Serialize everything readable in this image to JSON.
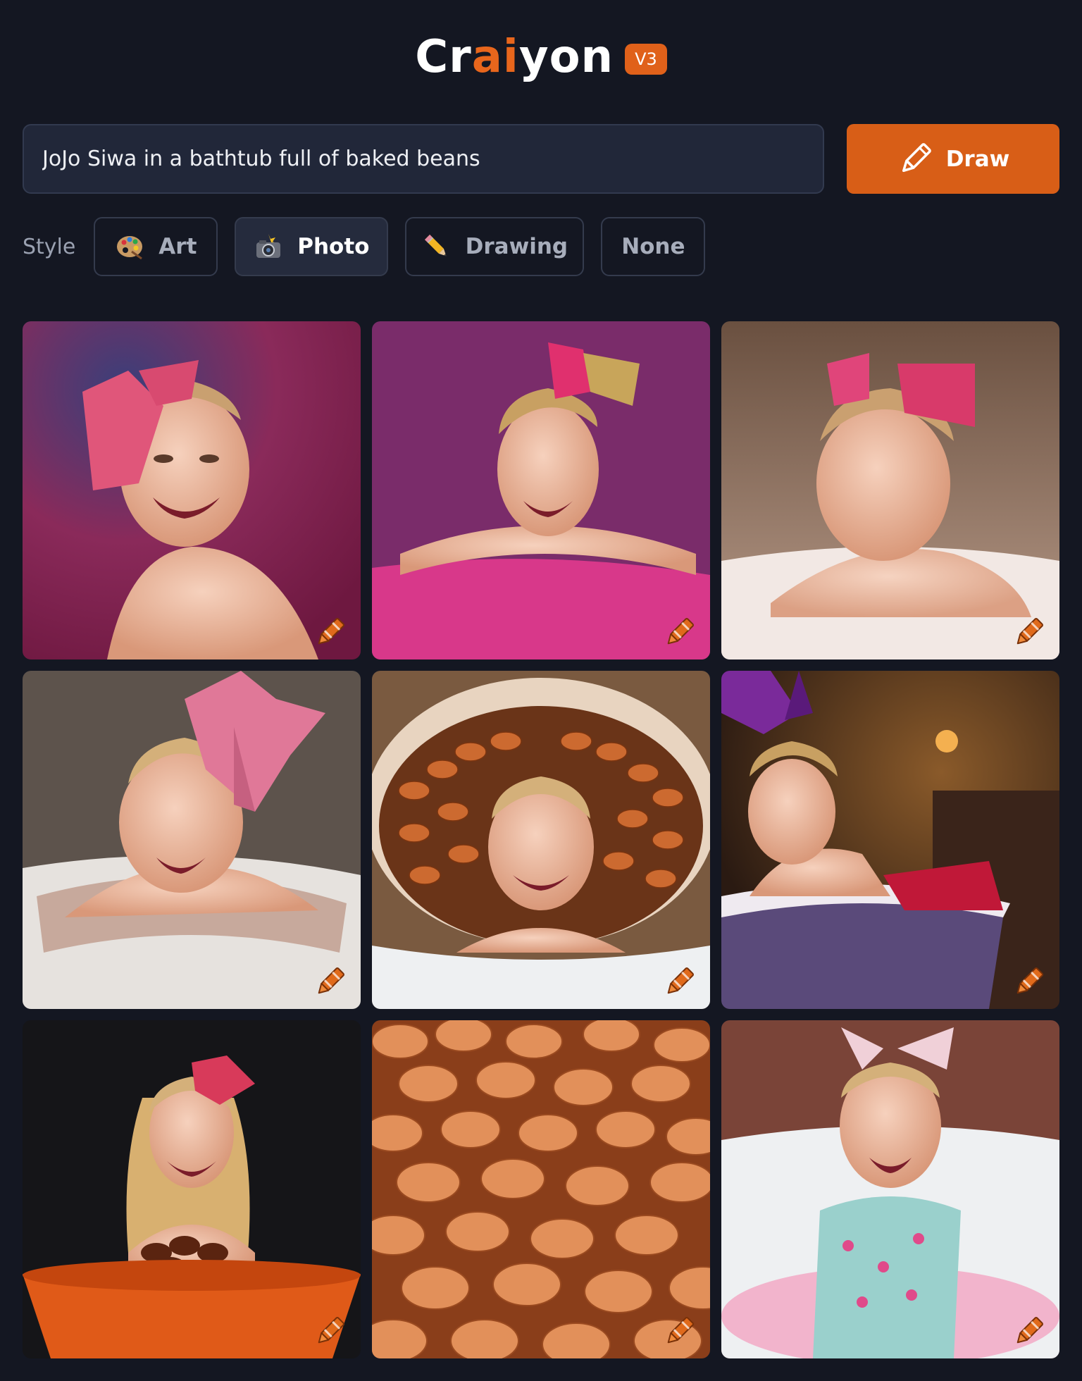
{
  "header": {
    "logo_pre": "Cr",
    "logo_ai": "ai",
    "logo_post": "yon",
    "version_badge": "V3"
  },
  "prompt": {
    "value": "JoJo Siwa in a bathtub full of baked beans"
  },
  "draw_button": {
    "label": "Draw",
    "icon": "pencil-icon"
  },
  "style": {
    "label": "Style",
    "options": [
      {
        "label": "Art",
        "icon": "palette-icon",
        "selected": false
      },
      {
        "label": "Photo",
        "icon": "camera-flash-icon",
        "selected": true
      },
      {
        "label": "Drawing",
        "icon": "pencil-icon",
        "selected": false
      },
      {
        "label": "None",
        "selected": false
      }
    ]
  },
  "results": {
    "images": [
      {
        "description": "girl with pink bow, magenta background",
        "badge_icon": "crayon-icon"
      },
      {
        "description": "girl with glitter bow leaning on pink tub",
        "badge_icon": "crayon-icon"
      },
      {
        "description": "girl with polka dot bow in white tub",
        "badge_icon": "crayon-icon"
      },
      {
        "description": "girl with large pink bow in white tub",
        "badge_icon": "crayon-icon"
      },
      {
        "description": "girl surrounded by baked beans in tub",
        "badge_icon": "crayon-icon"
      },
      {
        "description": "girl with purple bow in dim room tub",
        "badge_icon": "crayon-icon"
      },
      {
        "description": "girl behind orange bowl of beans",
        "badge_icon": "crayon-icon"
      },
      {
        "description": "close-up of baked beans",
        "badge_icon": "crayon-icon"
      },
      {
        "description": "girl in sequin outfit in bubble bath",
        "badge_icon": "crayon-icon"
      }
    ]
  },
  "colors": {
    "background": "#141722",
    "accent": "#d85e17",
    "input_bg": "#212739"
  }
}
